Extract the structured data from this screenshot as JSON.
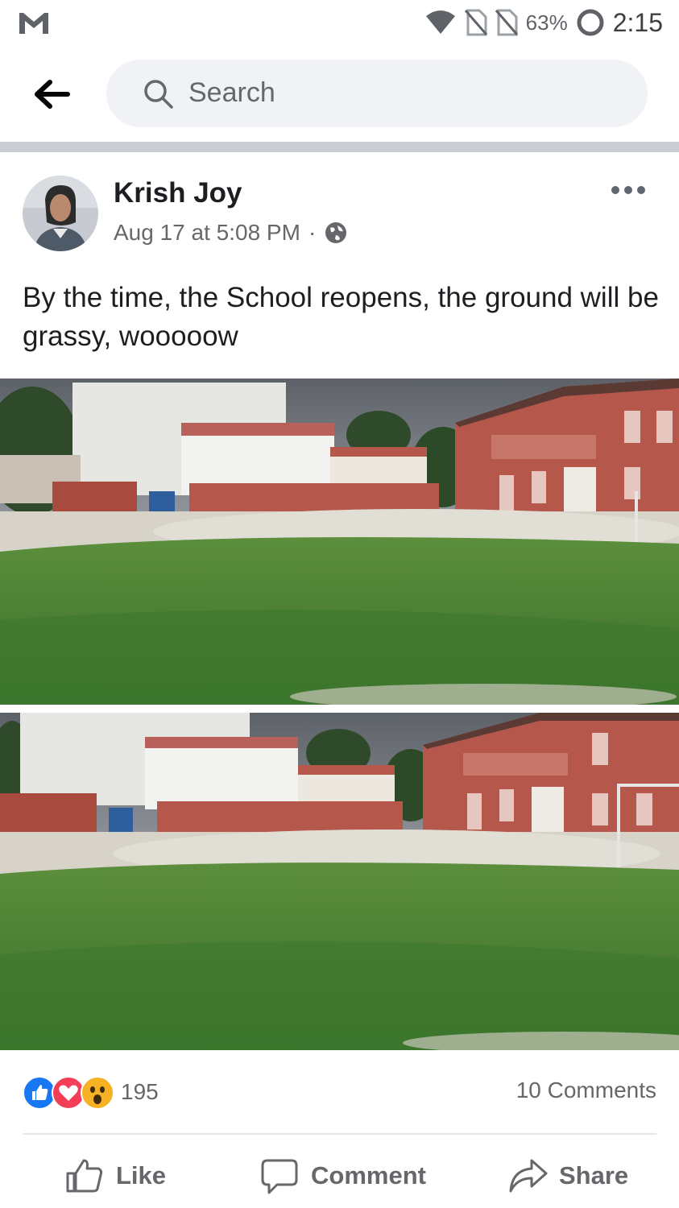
{
  "status_bar": {
    "battery_percent": "63%",
    "time": "2:15",
    "icons": [
      "gmail-icon",
      "wifi-icon",
      "no-sim-icon",
      "no-sim-icon",
      "battery-icon"
    ]
  },
  "search": {
    "placeholder": "Search"
  },
  "post": {
    "author": "Krish Joy",
    "timestamp": "Aug 17 at 5:08 PM",
    "separator": "·",
    "privacy_icon": "globe-icon",
    "text": "By the time, the School reopens, the ground will be grassy, wooooow",
    "photos": [
      "school-ground-photo",
      "school-ground-photo"
    ],
    "reaction_icons": [
      "like-icon",
      "love-icon",
      "wow-icon"
    ],
    "reaction_count": "195",
    "comments_count": "10 Comments"
  },
  "actions": {
    "like": "Like",
    "comment": "Comment",
    "share": "Share"
  },
  "colors": {
    "like_blue": "#1877f2",
    "love_red": "#f33e58",
    "wow_yellow": "#f7b125",
    "text_grey": "#65676b",
    "search_bg": "#f0f2f5",
    "brick_red": "#b5574a",
    "grass_green": "#3f7a2e"
  }
}
